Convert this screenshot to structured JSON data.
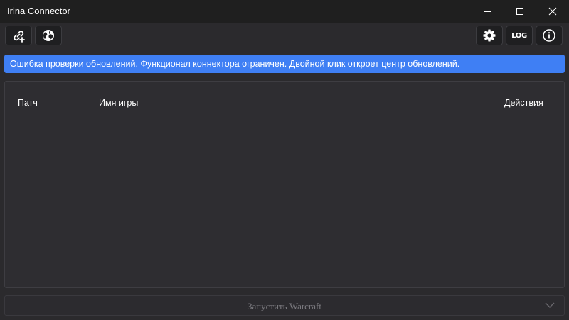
{
  "window": {
    "title": "Irina Connector",
    "controls": [
      "minimize",
      "maximize",
      "close"
    ]
  },
  "toolbar": {
    "left_buttons": [
      {
        "icon": "add-link-icon"
      },
      {
        "icon": "globe-icon"
      }
    ],
    "right_buttons": [
      {
        "icon": "gear-icon"
      },
      {
        "label": "LOG"
      },
      {
        "icon": "info-icon"
      }
    ],
    "log_label": "LOG"
  },
  "banner": {
    "text": "Ошибка проверки обновлений. Функционал коннектора ограничен. Двойной клик откроет центр обновлений.",
    "color": "#3f7ff4"
  },
  "table": {
    "columns": {
      "patch": "Патч",
      "game_name": "Имя игры",
      "actions": "Действия"
    },
    "rows": []
  },
  "launch": {
    "label": "Запустить Warcraft",
    "enabled": false
  },
  "colors": {
    "background": "#2b2a2d",
    "titlebar": "#1f1f1f",
    "accent": "#3f7ff4",
    "disabled_text": "#7c7b80"
  }
}
